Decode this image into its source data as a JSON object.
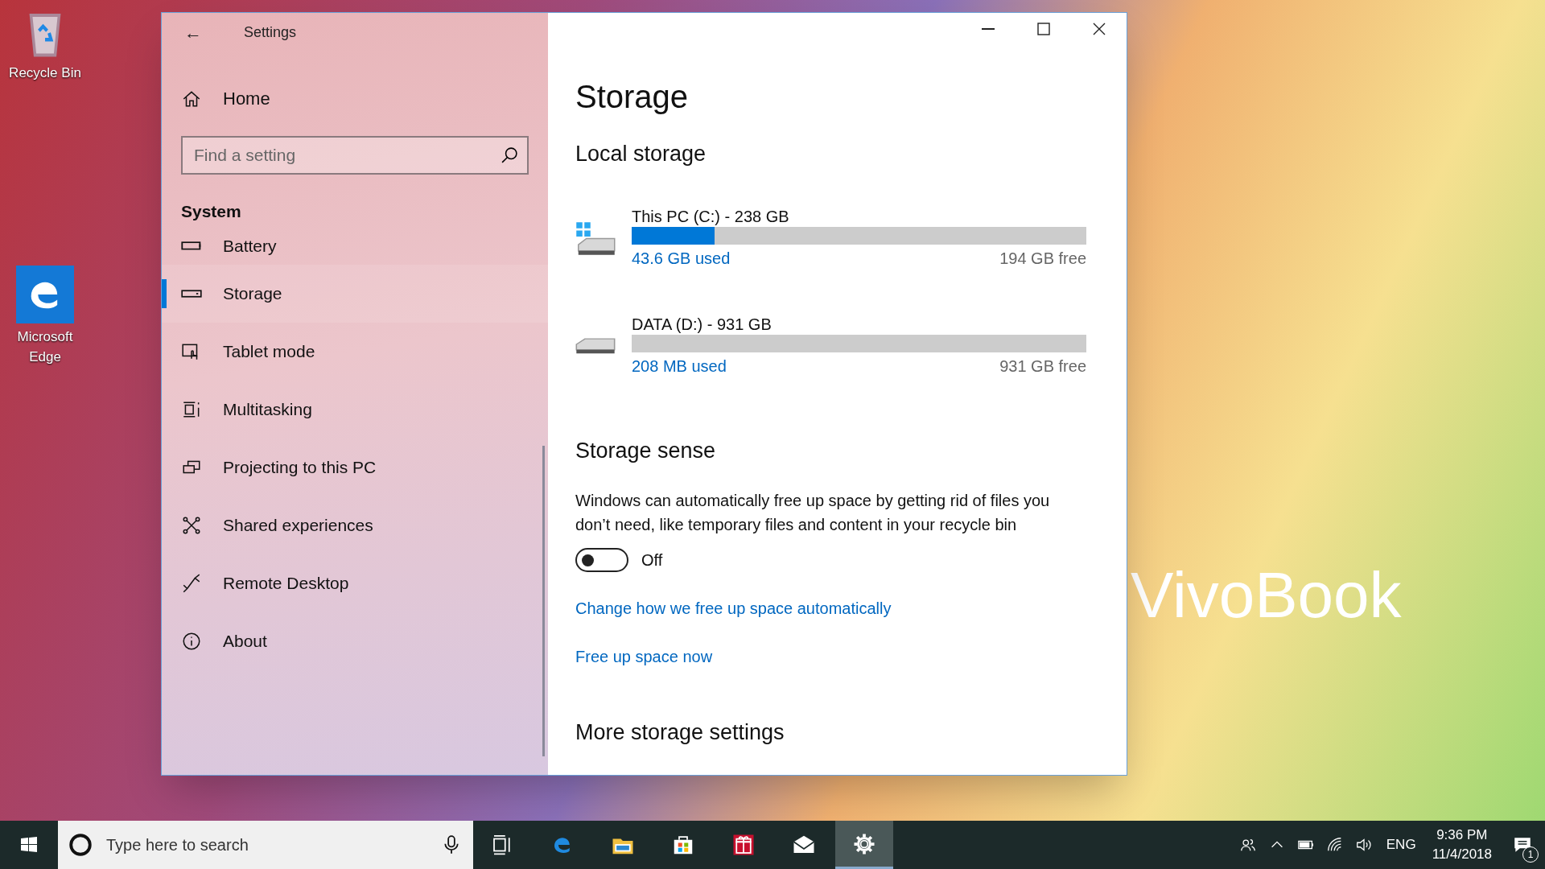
{
  "desktop_icons": [
    {
      "kind": "recycle",
      "label": "Recycle Bin"
    },
    {
      "kind": "edge",
      "label": "Microsoft Edge"
    }
  ],
  "wallpaper_text": "VivoBook",
  "window": {
    "title": "Settings",
    "back": "←"
  },
  "sidebar": {
    "home": "Home",
    "search": {
      "placeholder": "Find a setting"
    },
    "section": "System",
    "items": [
      {
        "kind": "battery",
        "label": "Battery",
        "selected": false
      },
      {
        "kind": "storage",
        "label": "Storage",
        "selected": true
      },
      {
        "kind": "tablet",
        "label": "Tablet mode",
        "selected": false
      },
      {
        "kind": "multitask",
        "label": "Multitasking",
        "selected": false
      },
      {
        "kind": "project",
        "label": "Projecting to this PC",
        "selected": false
      },
      {
        "kind": "shared",
        "label": "Shared experiences",
        "selected": false
      },
      {
        "kind": "remote",
        "label": "Remote Desktop",
        "selected": false
      },
      {
        "kind": "about",
        "label": "About",
        "selected": false
      }
    ]
  },
  "content": {
    "title": "Storage",
    "local_heading": "Local storage",
    "drives": [
      {
        "kind": "system",
        "name": "This PC (C:) - 238 GB",
        "level": 0.183,
        "used": "43.6 GB used",
        "free": "194 GB free"
      },
      {
        "kind": "data",
        "name": "DATA (D:) - 931 GB",
        "level": 0.0,
        "used": "208 MB used",
        "free": "931 GB free"
      }
    ],
    "sense_heading": "Storage sense",
    "sense_text": "Windows can automatically free up space by getting rid of files you don’t need, like temporary files and content in your recycle bin",
    "toggle": {
      "on": false,
      "label": "Off"
    },
    "links": [
      "Change how we free up space automatically",
      "Free up space now"
    ],
    "more_heading": "More storage settings"
  },
  "taskbar": {
    "search_placeholder": "Type here to search",
    "apps": [
      {
        "kind": "taskview",
        "selected": false
      },
      {
        "kind": "edge",
        "selected": false
      },
      {
        "kind": "explorer",
        "selected": false
      },
      {
        "kind": "store",
        "selected": false
      },
      {
        "kind": "gift",
        "selected": false
      },
      {
        "kind": "mail",
        "selected": false
      },
      {
        "kind": "settings",
        "selected": true
      }
    ],
    "language": "ENG",
    "time": "9:36 PM",
    "date": "11/4/2018",
    "notification_count": "1"
  }
}
